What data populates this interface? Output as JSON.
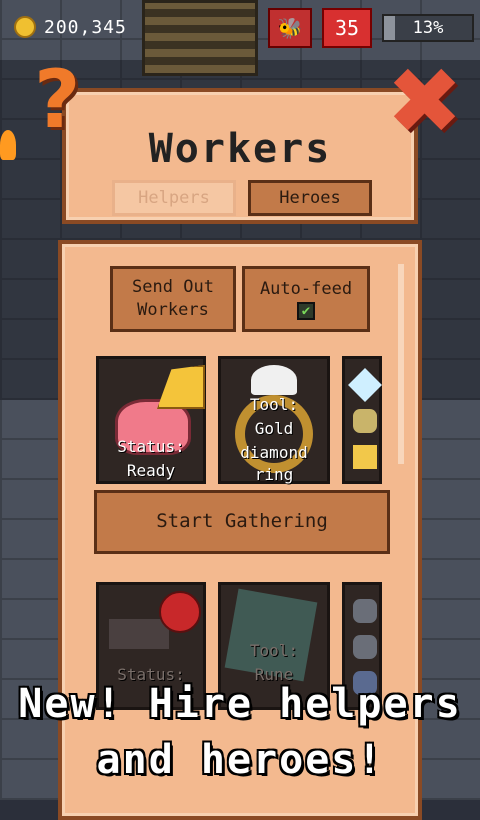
{
  "top_bar": {
    "gold_amount": "200,345",
    "level": "35",
    "xp_progress_label": "13%",
    "xp_progress": 0.13,
    "coin_icon": "gold-coin-icon",
    "pet_icon": "bee-icon"
  },
  "panel": {
    "title": "Workers",
    "tabs": [
      {
        "label": "Helpers",
        "active": false
      },
      {
        "label": "Heroes",
        "active": true
      }
    ]
  },
  "controls": {
    "send_out_label": "Send Out Workers",
    "send_out_line1": "Send Out",
    "send_out_line2": "Workers",
    "autofeed_label": "Auto-feed",
    "autofeed_checked": true
  },
  "worker_1": {
    "status_line1": "Status:",
    "status_line2": "Ready",
    "tool_line1": "Tool:",
    "tool_line2": "Gold",
    "tool_line3": "diamond",
    "tool_line4": "ring",
    "food_icon": "cheese-icon",
    "creature_icon": "pink-pig-icon",
    "gem_icons": [
      "diamond-icon",
      "ore-icon",
      "gold-bar-icon"
    ]
  },
  "gather_label": "Start Gathering",
  "worker_2": {
    "status_line1": "Status:",
    "tool_line1": "Tool:",
    "tool_line2": "Rune",
    "food_icon": "apple-icon",
    "creature_icon": "bat-icon",
    "gem_icons": [
      "ore-icon",
      "ore-icon",
      "ore-icon"
    ]
  },
  "caption_line1": "New! Hire helpers",
  "caption_line2": "and heroes!",
  "colors": {
    "panel_bg": "#f3b98f",
    "panel_border": "#8a4a24",
    "button_bg": "#c27a49",
    "accent_orange": "#f07a2a",
    "close_red": "#e4553a"
  }
}
